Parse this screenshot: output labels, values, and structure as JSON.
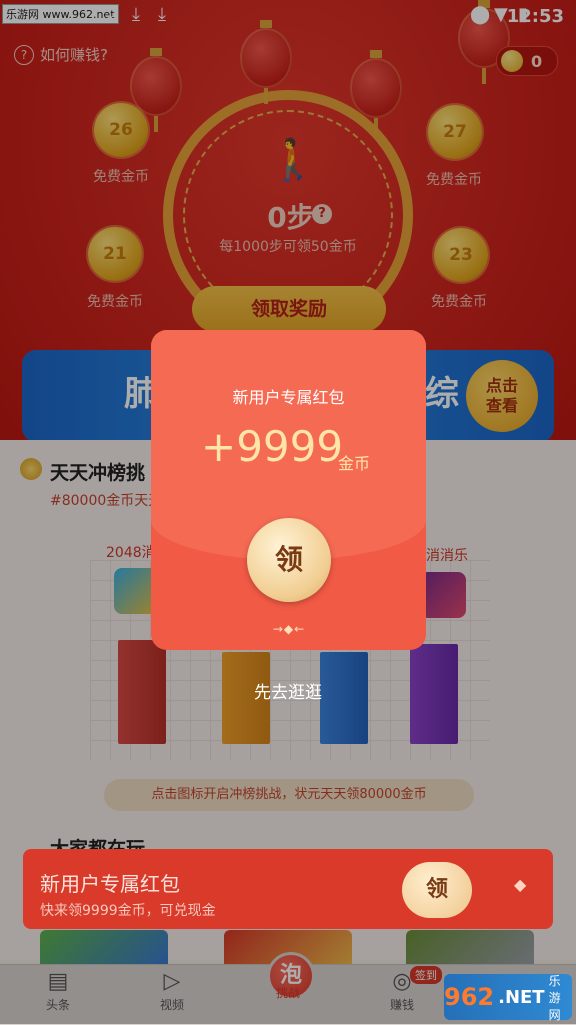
{
  "status_bar": {
    "watermark": "乐游网 www.962.net",
    "time": "12:53"
  },
  "header": {
    "how_to_earn": "如何赚钱?",
    "how_to_earn_q": "?",
    "coin_balance": "0"
  },
  "pedometer": {
    "steps": "0步",
    "steps_q": "?",
    "hint": "每1000步可领50金币",
    "claim_button": "领取奖励",
    "free_coins": [
      {
        "value": "26",
        "label": "免费金币"
      },
      {
        "value": "27",
        "label": "免费金币"
      },
      {
        "value": "21",
        "label": "免费金币"
      },
      {
        "value": "23",
        "label": "免费金币"
      }
    ]
  },
  "banner": {
    "text_left": "肺",
    "text_right": "综",
    "look_button_line1": "点击",
    "look_button_line2": "查看"
  },
  "leaderboard": {
    "title": "天天冲榜挑",
    "subtitle": "#80000金币天天",
    "game_left": "2048消",
    "game_right": "消消乐",
    "hint": "点击图标开启冲榜挑战，状元天天领80000金币",
    "bar_heights_fraction": [
      0.72,
      0.62,
      0.62,
      0.68
    ]
  },
  "section_everyone": "大家都在玩",
  "modal": {
    "title": "新用户专属红包",
    "amount": "+9999",
    "unit": "金币",
    "claim_seal": "领",
    "deco": "→◆←",
    "browse_first": "先去逛逛"
  },
  "floating_bar": {
    "title": "新用户专属红包",
    "subtitle": "快来领9999金币，可兑现金",
    "claim": "领",
    "deco": "◆"
  },
  "tab_bar": {
    "tabs": [
      {
        "label": "头条",
        "icon": "news-icon"
      },
      {
        "label": "视频",
        "icon": "play-icon"
      },
      {
        "label": "挑战",
        "icon": "challenge-icon"
      },
      {
        "label": "赚钱",
        "icon": "earn-icon"
      }
    ],
    "challenge_glyph": "泡",
    "sign_in_badge": "签到"
  },
  "watermark_bottom": {
    "num": "962",
    "net": ".NET",
    "cn": "乐游网"
  },
  "colors": {
    "primary_red": "#c91f19",
    "gold": "#e6a526",
    "envelope": "#f15a45"
  }
}
